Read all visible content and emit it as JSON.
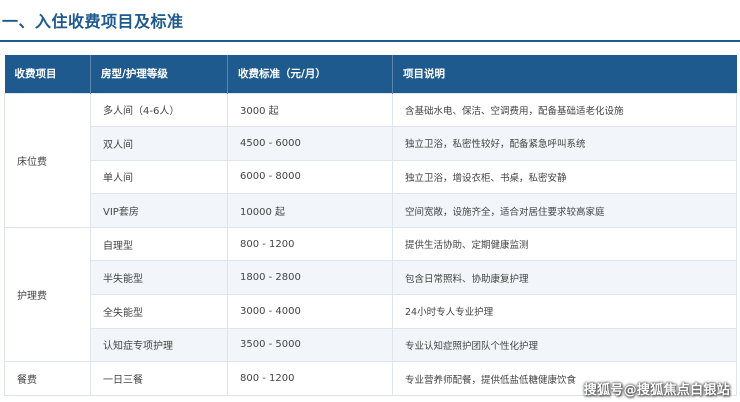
{
  "heading": {
    "title": "一、入住收费项目及标准"
  },
  "table": {
    "headers": [
      "收费项目",
      "房型/护理等级",
      "收费标准（元/月）",
      "项目说明"
    ],
    "groups": [
      {
        "category": "床位费",
        "rows": [
          {
            "type": "多人间（4-6人）",
            "price": "3000 起",
            "desc": "含基础水电、保洁、空调费用，配备基础适老化设施"
          },
          {
            "type": "双人间",
            "price": "4500 - 6000",
            "desc": "独立卫浴，私密性较好，配备紧急呼叫系统"
          },
          {
            "type": "单人间",
            "price": "6000 - 8000",
            "desc": "独立卫浴，增设衣柜、书桌，私密安静"
          },
          {
            "type": "VIP套房",
            "price": "10000 起",
            "desc": "空间宽敞，设施齐全，适合对居住要求较高家庭"
          }
        ]
      },
      {
        "category": "护理费",
        "rows": [
          {
            "type": "自理型",
            "price": "800 - 1200",
            "desc": "提供生活协助、定期健康监测"
          },
          {
            "type": "半失能型",
            "price": "1800 - 2800",
            "desc": "包含日常照料、协助康复护理"
          },
          {
            "type": "全失能型",
            "price": "3000 - 4000",
            "desc": "24小时专人专业护理"
          },
          {
            "type": "认知症专项护理",
            "price": "3500 - 5000",
            "desc": "专业认知症照护团队个性化护理"
          }
        ]
      },
      {
        "category": "餐费",
        "rows": [
          {
            "type": "一日三餐",
            "price": "800 - 1200",
            "desc": "专业营养师配餐，提供低盐低糖健康饮食"
          }
        ]
      }
    ]
  },
  "watermark": {
    "text": "搜狐号@搜狐焦点白银站"
  }
}
